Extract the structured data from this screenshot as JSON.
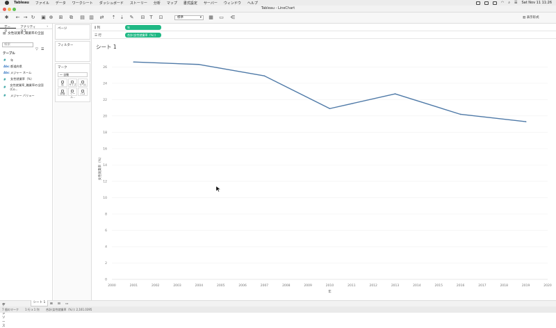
{
  "menubar": {
    "app": "Tableau",
    "items": [
      "ファイル",
      "データ",
      "ワークシート",
      "ダッシュボード",
      "ストーリー",
      "分析",
      "マップ",
      "書式設定",
      "サーバー",
      "ウィンドウ",
      "ヘルプ"
    ],
    "clock": "Sat Nov 11 11:26"
  },
  "window": {
    "title": "Tableau - LineChart"
  },
  "toolbar": {
    "mark_size": "標準",
    "show_me": "表示形式"
  },
  "left_pane": {
    "tab_data": "データ",
    "tab_analytics": "アナリティクス",
    "datasource": "女性就業率_職業率の全国",
    "search_placeholder": "検索",
    "tables_label": "テーブル",
    "fields": [
      {
        "type": "#",
        "name": "年"
      },
      {
        "type": "Abc",
        "name": "都道府県"
      },
      {
        "type": "Abc",
        "name": "メジャー ネーム"
      },
      {
        "type": "#",
        "name": "女性就業率（%）"
      },
      {
        "type": "#",
        "name": "女性就業率_職業率の全国 (Co..."
      },
      {
        "type": "#",
        "name": "メジャー バリュー"
      }
    ]
  },
  "cards": {
    "pages": "ページ",
    "filters": "フィルター",
    "marks": "マーク",
    "mark_type": "自動",
    "buttons": [
      "色",
      "サイズ",
      "ラベル",
      "詳細",
      "ツール...",
      "パス"
    ]
  },
  "shelves": {
    "columns_label": "列",
    "columns_pill": "年",
    "rows_label": "行",
    "rows_pill": "合計(女性就業率（%）)"
  },
  "sheet": {
    "title": "シート 1"
  },
  "chart_data": {
    "type": "line",
    "xlabel": "年",
    "ylabel": "女性就業率（%）",
    "x_ticks": [
      2000,
      2001,
      2002,
      2003,
      2004,
      2005,
      2006,
      2007,
      2008,
      2009,
      2010,
      2011,
      2012,
      2013,
      2014,
      2015,
      2016,
      2017,
      2018,
      2019,
      2020
    ],
    "y_ticks": [
      0,
      2,
      4,
      6,
      8,
      10,
      12,
      14,
      16,
      18,
      20,
      22,
      24,
      26
    ],
    "xlim": [
      2000,
      2020
    ],
    "ylim": [
      0,
      27.3
    ],
    "series": [
      {
        "x": [
          2001,
          2004,
          2007,
          2010,
          2013,
          2016,
          2019
        ],
        "values": [
          26.6,
          26.3,
          24.9,
          20.9,
          22.7,
          20.2,
          19.3
        ]
      }
    ],
    "line_color": "#4e79a7",
    "grid": true
  },
  "bottom": {
    "datasource_tab": "データ ソース",
    "sheet_tab": "シート 1"
  },
  "status": {
    "marks": "7 個のマーク",
    "dims": "1 行 x 1 列",
    "sum": "合計(女性就業率（%）): 2,161.0395"
  },
  "colors": {
    "pill": "#1fb884",
    "line": "#4e79a7"
  }
}
